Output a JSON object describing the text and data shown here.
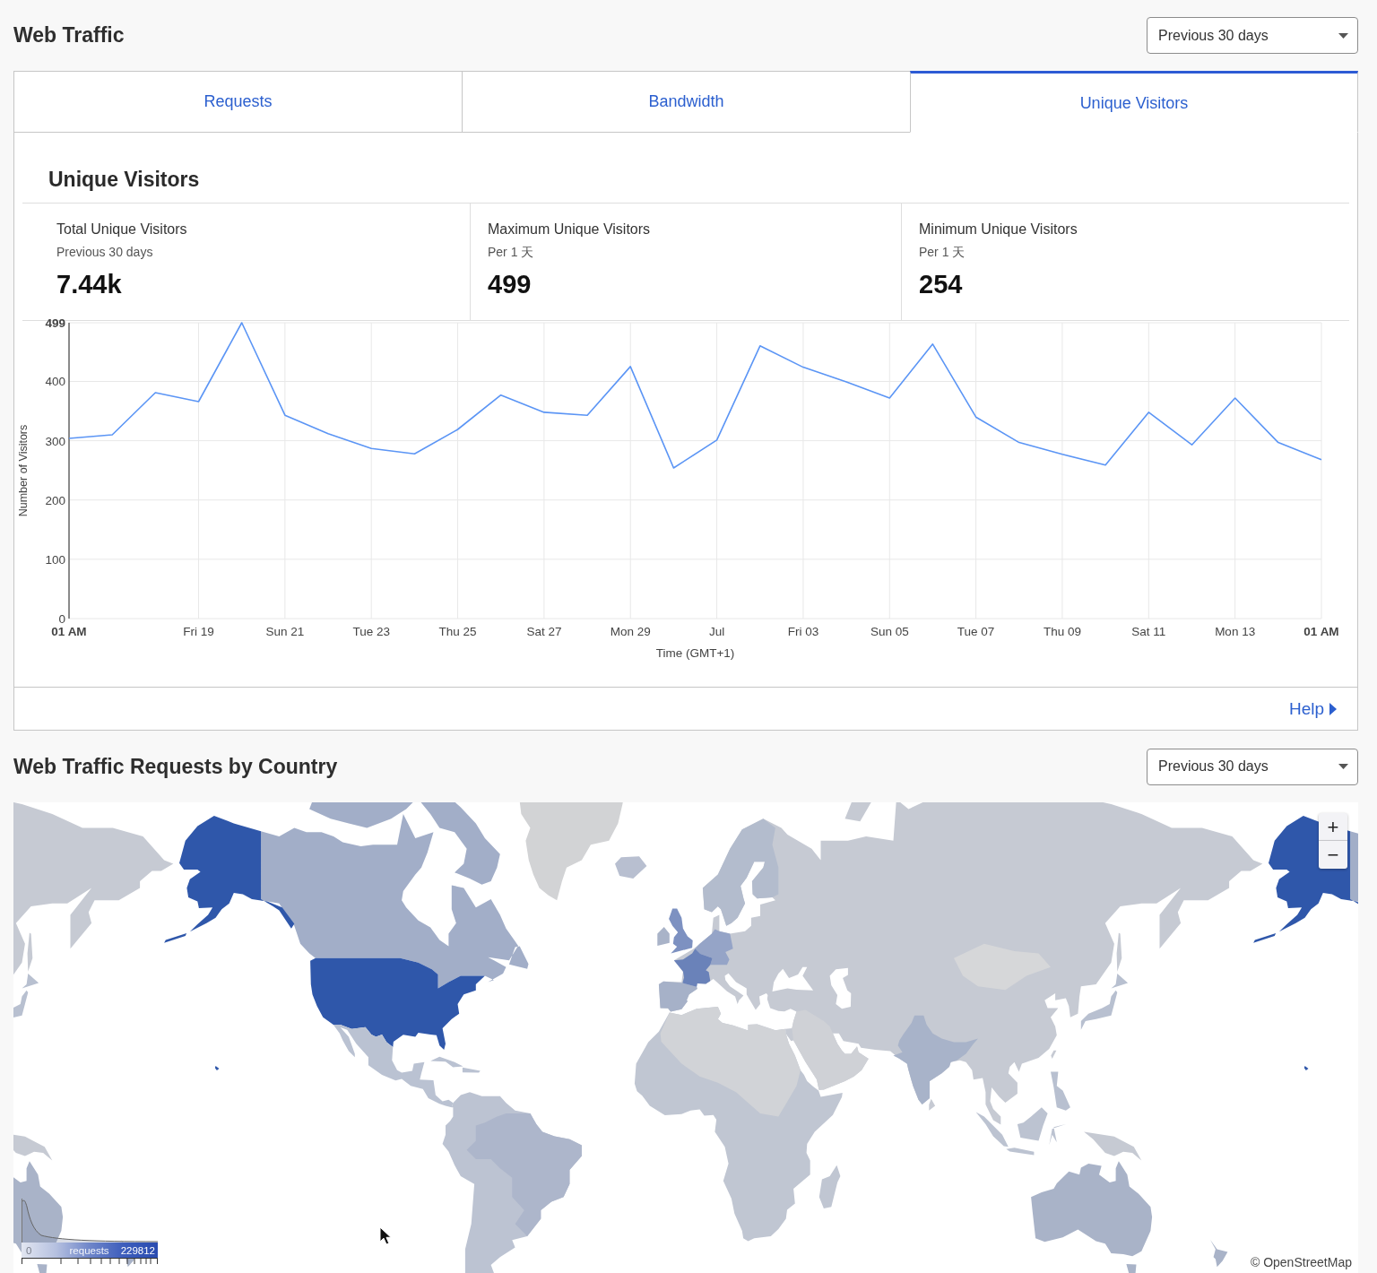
{
  "header": {
    "title": "Web Traffic",
    "range_select": {
      "value": "Previous 30 days"
    }
  },
  "tabs": [
    {
      "label": "Requests",
      "selected": false
    },
    {
      "label": "Bandwidth",
      "selected": false
    },
    {
      "label": "Unique Visitors",
      "selected": true
    }
  ],
  "panel": {
    "title": "Unique Visitors",
    "stats": [
      {
        "label": "Total Unique Visitors",
        "period": "Previous 30 days",
        "value": "7.44k"
      },
      {
        "label": "Maximum Unique Visitors",
        "period": "Per 1 天",
        "value": "499"
      },
      {
        "label": "Minimum Unique Visitors",
        "period": "Per 1 天",
        "value": "254"
      }
    ],
    "chart_data": {
      "type": "line",
      "xlabel": "Time (GMT+1)",
      "ylabel": "Number of Visitors",
      "categories": [
        "01 AM",
        null,
        null,
        "Fri 19",
        null,
        "Sun 21",
        null,
        "Tue 23",
        null,
        "Thu 25",
        null,
        "Sat 27",
        null,
        "Mon 29",
        null,
        "Jul",
        null,
        "Fri 03",
        null,
        "Sun 05",
        null,
        "Tue 07",
        null,
        "Thu 09",
        null,
        "Sat 11",
        null,
        "Mon 13",
        null,
        "01 AM"
      ],
      "series": [
        {
          "color": "#5b95f5",
          "values": [
            304,
            310,
            381,
            366,
            499,
            343,
            312,
            287,
            278,
            319,
            377,
            348,
            343,
            425,
            254,
            301,
            460,
            424,
            399,
            372,
            463,
            340,
            297,
            277,
            259,
            348,
            293,
            372,
            297,
            268
          ]
        }
      ],
      "ylim": [
        0,
        499
      ],
      "yticks": [
        0,
        100,
        200,
        300,
        400,
        {
          "value": 499,
          "label": "499"
        }
      ],
      "grid": true
    },
    "help_link": "Help"
  },
  "country_section": {
    "title": "Web Traffic Requests by Country",
    "range_select": {
      "value": "Previous 30 days"
    },
    "map": {
      "zoom_in": "+",
      "zoom_out": "−",
      "legend": {
        "min": "0",
        "title": "requests",
        "max": "229812"
      },
      "attribution": "© OpenStreetMap"
    }
  }
}
